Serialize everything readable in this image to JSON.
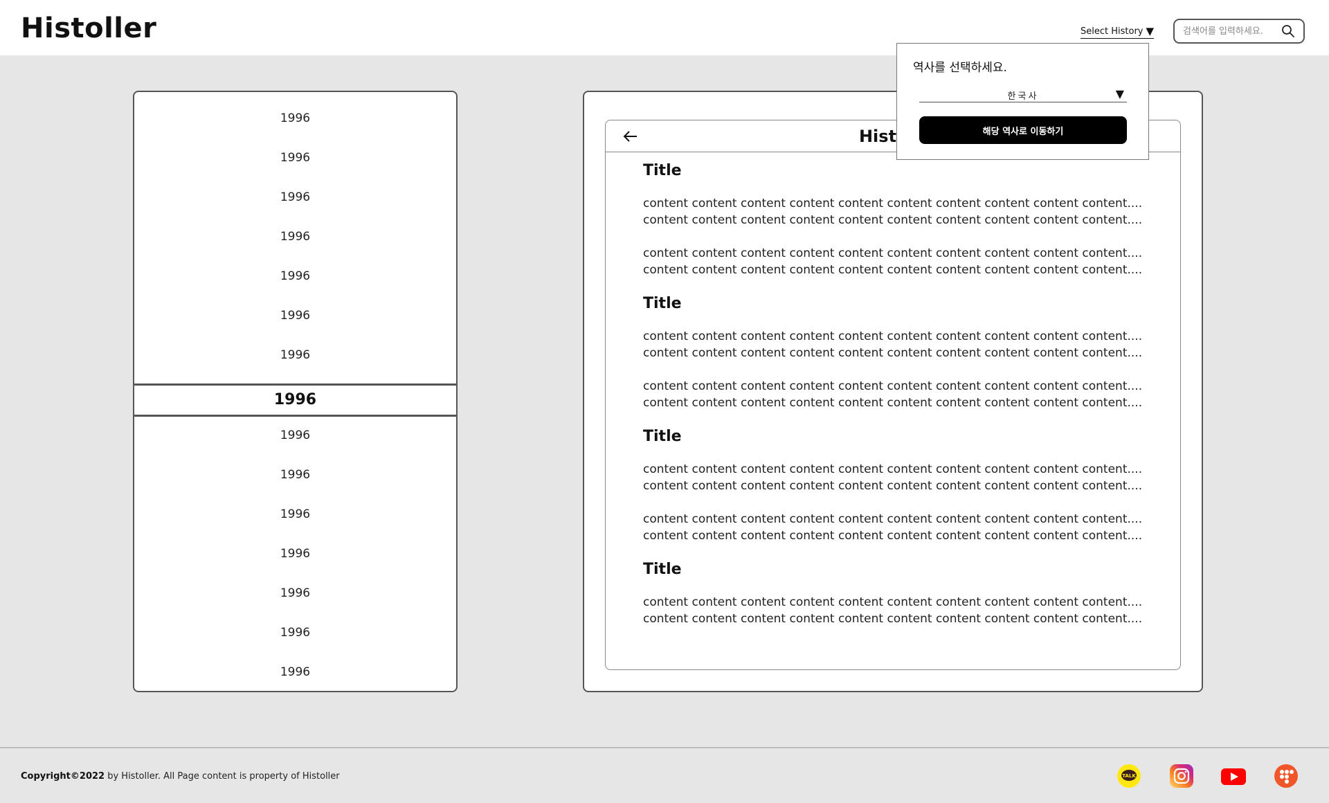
{
  "header": {
    "logo": "Histoller",
    "select_history_label": "Select History",
    "select_history_caret": "▼",
    "search_placeholder": "검색어를 입력하세요."
  },
  "years": {
    "items": [
      "1996",
      "1996",
      "1996",
      "1996",
      "1996",
      "1996",
      "1996",
      "1996",
      "1996",
      "1996",
      "1996",
      "1996",
      "1996",
      "1996",
      "1996"
    ],
    "selected_index": 7
  },
  "content": {
    "header_title": "History",
    "sections": [
      {
        "title": "Title",
        "paragraphs": [
          [
            "content content content content content content content content content content....",
            "content content content content content content content content content content...."
          ],
          [
            "content content content content content content content content content content....",
            "content content content content content content content content content content...."
          ]
        ]
      },
      {
        "title": "Title",
        "paragraphs": [
          [
            "content content content content content content content content content content....",
            "content content content content content content content content content content...."
          ],
          [
            "content content content content content content content content content content....",
            "content content content content content content content content content content...."
          ]
        ]
      },
      {
        "title": "Title",
        "paragraphs": [
          [
            "content content content content content content content content content content....",
            "content content content content content content content content content content...."
          ],
          [
            "content content content content content content content content content content....",
            "content content content content content content content content content content...."
          ]
        ]
      },
      {
        "title": "Title",
        "paragraphs": [
          [
            "content content content content content content content content content content....",
            "content content content content content content content content content content...."
          ]
        ]
      }
    ]
  },
  "popup": {
    "title": "역사를 선택하세요.",
    "selected_value": "한국사",
    "caret": "▼",
    "button_label": "해당 역사로 이동하기"
  },
  "footer": {
    "copyright_bold": "Copyright©2022",
    "copyright_rest": " by Histoller. All Page content is property of Histoller",
    "social": [
      {
        "name": "kakaotalk-icon",
        "label": "TALK",
        "color": "#FFE812"
      },
      {
        "name": "instagram-icon",
        "color": "#E1306C"
      },
      {
        "name": "youtube-icon",
        "color": "#FF0000"
      },
      {
        "name": "twitch-icon",
        "color": "#F0562A"
      }
    ]
  }
}
